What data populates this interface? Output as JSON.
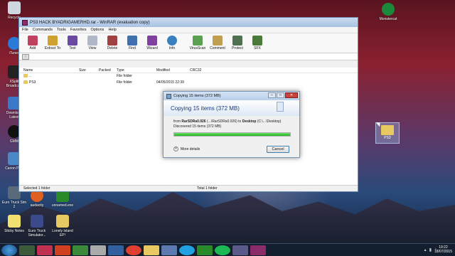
{
  "window": {
    "title": "PS3 HACK BYADRIGAMERHD.rar - WinRAR (evaluation copy)",
    "menu": [
      "File",
      "Commands",
      "Tools",
      "Favorites",
      "Options",
      "Help"
    ],
    "toolbar": [
      "Add",
      "Extract To",
      "Test",
      "View",
      "Delete",
      "Find",
      "Wizard",
      "Info",
      "VirusScan",
      "Comment",
      "Protect",
      "SFX"
    ],
    "columns": [
      "Name",
      "Size",
      "Packed",
      "Type",
      "Modified",
      "CRC32"
    ],
    "rows": [
      {
        "name": "..",
        "size": "",
        "packed": "",
        "type": "File folder",
        "modified": "",
        "crc": ""
      },
      {
        "name": "PS3",
        "size": "",
        "packed": "",
        "type": "File folder",
        "modified": "04/05/2015 22:39",
        "crc": ""
      }
    ],
    "status_left": "Selected 1 folder",
    "status_right": "Total 1 folder"
  },
  "dialog": {
    "title": "Copying 15 items (372 MB)",
    "heading": "Copying 15 items (372 MB)",
    "from_prefix": "from",
    "from_src": "RarSDRa0.926",
    "from_mid": "(...\\RarSDRa0.926) to",
    "from_dest": "Desktop",
    "from_suffix": "(C:\\...\\Desktop)",
    "discovered": "Discovered 15 items (372 MB)",
    "progress": 1.0,
    "more_details": "More details",
    "cancel": "Cancel"
  },
  "desktop": {
    "icons_left": [
      "Recycle",
      "iTunes",
      "XSplit Broadcast",
      "Download Latest",
      "GMM",
      "Canon Plus",
      "Euro Truck Sim 2"
    ],
    "icons_top": [
      "Monstercat"
    ],
    "icons_bottom": [
      "Sticky Notes",
      "Euro Truck Simulator...",
      "Lonely Island EP!"
    ],
    "icons_mid_bottom": [
      "audacity",
      "unnamed.exe"
    ],
    "dragged_folder": "PS3"
  },
  "taskbar": {
    "time": "19:22",
    "date": "18/07/2015"
  },
  "colors": {
    "progress": "#1fb61f",
    "title_blue": "#1a3a7a"
  }
}
